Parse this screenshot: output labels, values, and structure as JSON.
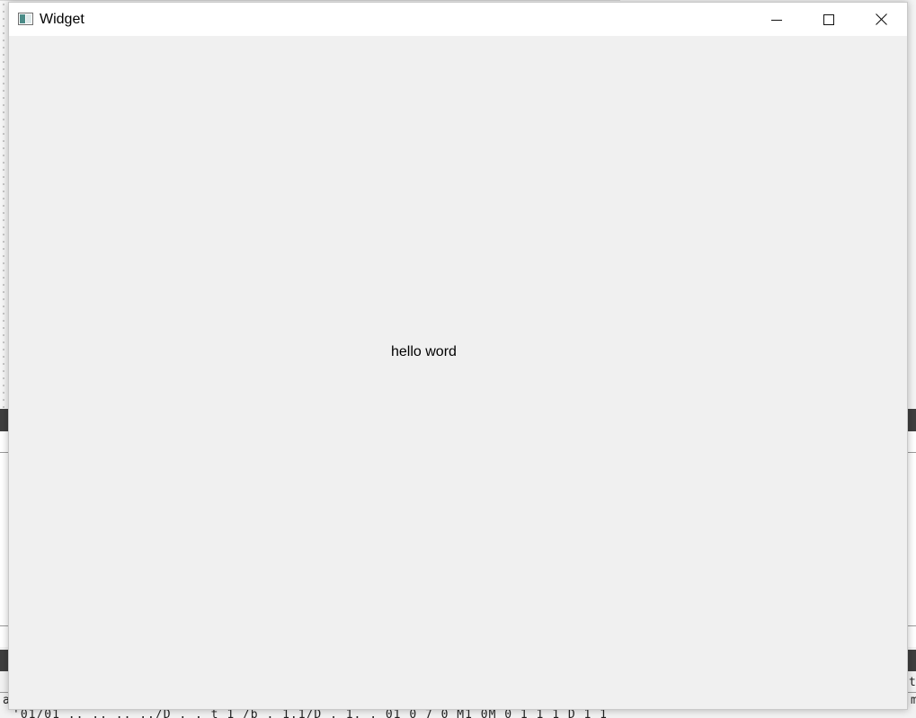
{
  "window": {
    "title": "Widget",
    "controls": {
      "minimize_icon": "minimize-icon",
      "maximize_icon": "maximize-icon",
      "close_icon": "close-icon"
    }
  },
  "content": {
    "label_text": "hello word"
  },
  "background": {
    "console_line": "'01/01 .. .. ..  ../D  .  .  t 1 /b  .  1.1/D  .  1. .  01  0 7 0  M1  0M  0 1 1 1  D 1   1",
    "edge_left": "a",
    "edge_right_top": "t.",
    "edge_right_bottom": "m"
  },
  "colors": {
    "titlebar": "#ffffff",
    "client": "#f0f0f0",
    "dark_bar": "#3f3f3f",
    "icon_teal": "#4b8c88"
  }
}
